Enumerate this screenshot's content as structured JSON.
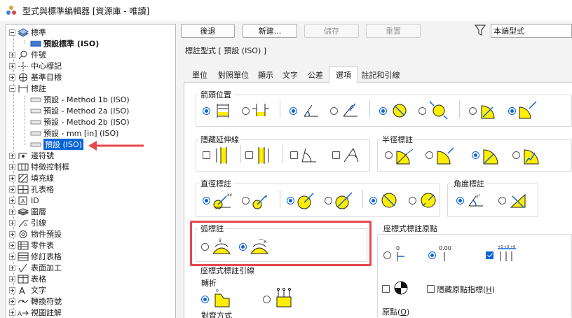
{
  "window": {
    "title": "型式與標準編輯器 [資源庫 - 唯讀]"
  },
  "tree": {
    "items": [
      {
        "label": "標準",
        "level": 0,
        "expander": "minus",
        "icon": "layers-icon"
      },
      {
        "label": "預設標準 (ISO)",
        "level": 1,
        "bold": true,
        "icon": "standard-icon"
      },
      {
        "label": "件號",
        "level": 0,
        "expander": "plus",
        "icon": "balloon-icon"
      },
      {
        "label": "中心標記",
        "level": 0,
        "expander": "plus",
        "icon": "center-mark-icon"
      },
      {
        "label": "基準目標",
        "level": 0,
        "expander": "plus",
        "icon": "datum-target-icon"
      },
      {
        "label": "標註",
        "level": 0,
        "expander": "minus",
        "icon": "dimension-icon"
      },
      {
        "label": "預設 - Method 1b (ISO)",
        "level": 1,
        "icon": "dim-style-icon"
      },
      {
        "label": "預設 - Method 2a (ISO)",
        "level": 1,
        "icon": "dim-style-icon"
      },
      {
        "label": "預設 - Method 2b (ISO)",
        "level": 1,
        "icon": "dim-style-icon"
      },
      {
        "label": "預設 - mm [in] (ISO)",
        "level": 1,
        "icon": "dim-style-icon"
      },
      {
        "label": "預設 (ISO)",
        "level": 1,
        "selected": true,
        "icon": "dim-style-icon"
      },
      {
        "label": "邊符號",
        "level": 0,
        "expander": "plus",
        "icon": "edge-symbol-icon"
      },
      {
        "label": "特徵控制框",
        "level": 0,
        "expander": "plus",
        "icon": "feature-control-frame-icon"
      },
      {
        "label": "填充線",
        "level": 0,
        "expander": "plus",
        "icon": "hatch-icon"
      },
      {
        "label": "孔表格",
        "level": 0,
        "expander": "plus",
        "icon": "hole-table-icon"
      },
      {
        "label": "ID",
        "level": 0,
        "expander": "plus",
        "icon": "id-icon"
      },
      {
        "label": "圖層",
        "level": 0,
        "expander": "plus",
        "icon": "layer-icon"
      },
      {
        "label": "引線",
        "level": 0,
        "expander": "plus",
        "icon": "leader-icon"
      },
      {
        "label": "物件預設",
        "level": 0,
        "expander": "plus",
        "icon": "object-defaults-icon"
      },
      {
        "label": "零件表",
        "level": 0,
        "expander": "plus",
        "icon": "parts-list-icon"
      },
      {
        "label": "修訂表格",
        "level": 0,
        "expander": "plus",
        "icon": "revision-table-icon"
      },
      {
        "label": "表面加工",
        "level": 0,
        "expander": "plus",
        "icon": "surface-texture-icon"
      },
      {
        "label": "表格",
        "level": 0,
        "expander": "plus",
        "icon": "table-icon"
      },
      {
        "label": "文字",
        "level": 0,
        "expander": "plus",
        "icon": "text-icon"
      },
      {
        "label": "轉換符號",
        "level": 0,
        "expander": "plus",
        "icon": "transition-symbol-icon"
      },
      {
        "label": "視圖註解",
        "level": 0,
        "expander": "plus",
        "icon": "view-annotation-icon"
      }
    ]
  },
  "toolbar": {
    "back": "後退",
    "new": "新建...",
    "save": "儲存",
    "reset": "重置",
    "filter_value": "本端型式"
  },
  "header": {
    "section_title": "標註型式 [ 預設 (ISO) ]"
  },
  "tabs": [
    {
      "label": "單位"
    },
    {
      "label": "對照單位"
    },
    {
      "label": "顯示"
    },
    {
      "label": "文字"
    },
    {
      "label": "公差"
    },
    {
      "label": "選項",
      "active": true
    },
    {
      "label": "註記和引線"
    }
  ],
  "groups": {
    "arrowhead_position": "箭頭位置",
    "hide_extension_lines": "隱藏延伸線",
    "radius_dimension": "半徑標註",
    "diameter_dimension": "直徑標註",
    "angular_dimension": "角度標註",
    "arc_dimension": "弧標註",
    "ordinate_origin": "座標式標註原點",
    "ordinate_leader": "座標式標註引線",
    "jog": "轉折",
    "alignment": "對齊方式",
    "hide_origin_indicator": "隱藏原點指標(",
    "hide_origin_indicator_key": "H",
    "hide_origin_indicator_end": ")",
    "origin": "原點(",
    "origin_key": "O",
    "origin_end": ")"
  },
  "colors": {
    "accent": "#0a64d8",
    "symbol_fill": "#ffee00",
    "highlight": "#e5484d",
    "selection": "#0a64d8"
  }
}
